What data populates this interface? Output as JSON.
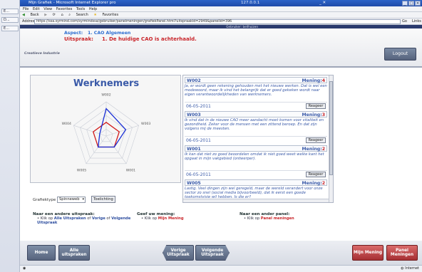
{
  "sidebar": {
    "items": [
      "E...",
      "D...",
      "E..."
    ]
  },
  "browser": {
    "title": "Mijn Grafiek - Microsoft Internet Explorer pro",
    "center_host": "127.0.0.1",
    "window_controls": "_ ✕",
    "menu": [
      "File",
      "Edit",
      "View",
      "Favorites",
      "Tools",
      "Help"
    ],
    "toolbar": [
      "Back",
      "Search",
      "Favorites"
    ],
    "address_label": "Address",
    "address_value": "https://ssa.syrmind.com/syrmindssa/gebruiker/panelmeningen/grafiekPanel.html?uitspraakId=2949&panelId=396",
    "go_label": "Go",
    "links_label": "Links",
    "status_zone": "Internet"
  },
  "header": {
    "user": "Gebruiker: bellhuizen",
    "brand": "Creatieve Industrie",
    "aspect_label": "Aspect:",
    "aspect_value": "1. CAO Algemeen",
    "statement_label": "Uitspraak:",
    "statement_value": "1. De huidige CAO is achterhaald.",
    "logout_label": "Logout"
  },
  "chart_data": {
    "type": "radar",
    "title": "Werknemers",
    "categories": [
      "W002",
      "W003",
      "W001",
      "W005",
      "W004"
    ],
    "series": [
      {
        "color": "#1a2fd6",
        "values": [
          4,
          3,
          2,
          2,
          1
        ]
      },
      {
        "color": "#d11b1b",
        "values": [
          2,
          2,
          2,
          2,
          2
        ]
      }
    ],
    "ylim": [
      0,
      5
    ],
    "grid": true
  },
  "controls": {
    "grafiek_label": "Grafiektype",
    "grafiek_value": "Spinneweb",
    "toelichting_label": "Toelichting"
  },
  "opinions": [
    {
      "id": "W002",
      "mening_label": "Mening:",
      "mening": "4",
      "text": "Ja, er wordt geen rekening gehouden met het nieuwe werken. Dat is wel een modewoord, maar ik vind het belangrijk dat er goed gekeken wordt naar eigen verantwoordelijkheden van werknemers.",
      "date": "06-05-2011",
      "react": "Reageer"
    },
    {
      "id": "W003",
      "mening_label": "Mening:",
      "mening": "3",
      "text": "Ik vind dat in de nieuwe CAO meer aandacht moet komen voor vitaliteit en gezondheid. Zeker voor de mensen met een zittend beroep. En dat zijn volgens mij de meesten.",
      "date": "06-05-2011",
      "react": "Reageer"
    },
    {
      "id": "W001",
      "mening_label": "Mening:",
      "mening": "2",
      "text": "Ik kan dat niet zo goed beoordelen omdat ik niet goed weet welke kant het opgaat in mijn vakgebied (ontwerper).",
      "date": "06-05-2011",
      "react": "Reageer"
    },
    {
      "id": "W005",
      "mening_label": "Mening:",
      "mening": "2",
      "text": "Lastig. Veel dingen zijn wel geregeld, maar de wereld verandert voor onze sector zo snel (social media bijvoorbeeld), dat ik eerst een goede toekomstvisie wil hebben. Is die er?",
      "date": "",
      "react": ""
    }
  ],
  "help": {
    "col1_head": "Naar een andere uitspraak:",
    "col1_line": "Klik op",
    "col1_a": "Alle Uitspraken",
    "col1_of": "of",
    "col1_b": "Vorige",
    "col1_of2": "of",
    "col1_c": "Volgende Uitspraak",
    "col2_head": "Geef uw mening:",
    "col2_line": "Klik op",
    "col2_a": "Mijn Mening",
    "col3_head": "Naar een ander panel:",
    "col3_line": "Klik op",
    "col3_a": "Panel meningen"
  },
  "nav": {
    "home": "Home",
    "alle": "Alle uitspraken",
    "vorige": "Vorige Uitspraak",
    "volgende": "Volgende Uitspraak",
    "mijn": "Mijn Mening",
    "panel": "Panel Meningen"
  }
}
